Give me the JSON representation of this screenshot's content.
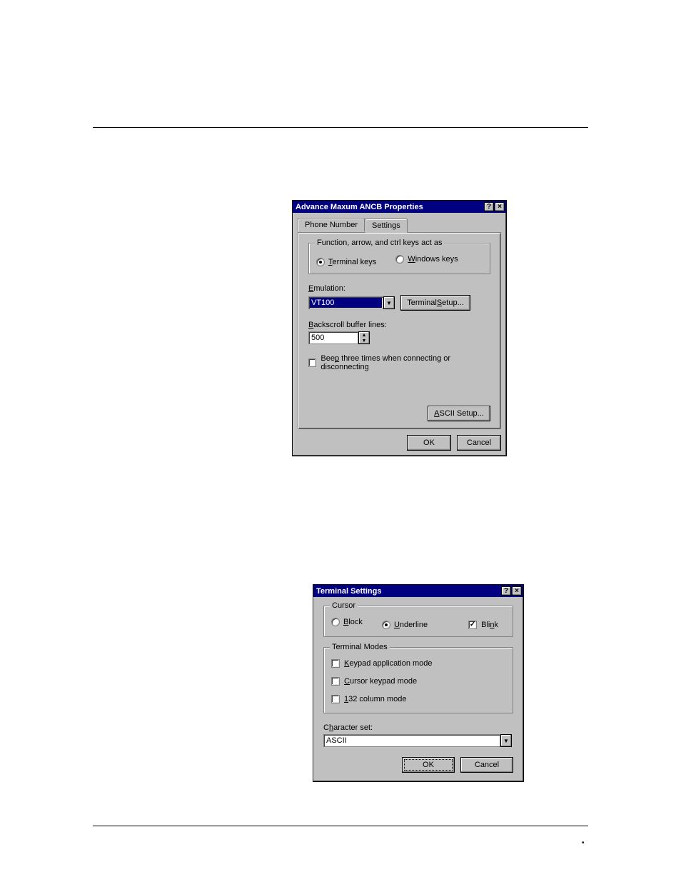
{
  "dlg1": {
    "title": "Advance Maxum ANCB Properties",
    "tabs": {
      "phone": "Phone Number",
      "settings": "Settings"
    },
    "keysGroup": "Function, arrow, and ctrl keys act as",
    "radioTerminal": "Terminal keys",
    "radioWindows": "Windows keys",
    "emulationLabel": "Emulation:",
    "emulationValue": "VT100",
    "terminalSetupBtn": "Terminal Setup...",
    "backscrollLabel": "Backscroll buffer lines:",
    "backscrollValue": "500",
    "beepLabel": "Beep three times when connecting or disconnecting",
    "asciiBtn": "ASCII Setup...",
    "ok": "OK",
    "cancel": "Cancel"
  },
  "dlg2": {
    "title": "Terminal Settings",
    "cursorGroup": "Cursor",
    "radioBlock": "Block",
    "radioUnderline": "Underline",
    "chkBlink": "Blink",
    "modesGroup": "Terminal Modes",
    "chkKeypad": "Keypad application mode",
    "chkCursorKeypad": "Cursor keypad mode",
    "chk132": "132 column mode",
    "charsetLabel": "Character set:",
    "charsetValue": "ASCII",
    "ok": "OK",
    "cancel": "Cancel"
  }
}
